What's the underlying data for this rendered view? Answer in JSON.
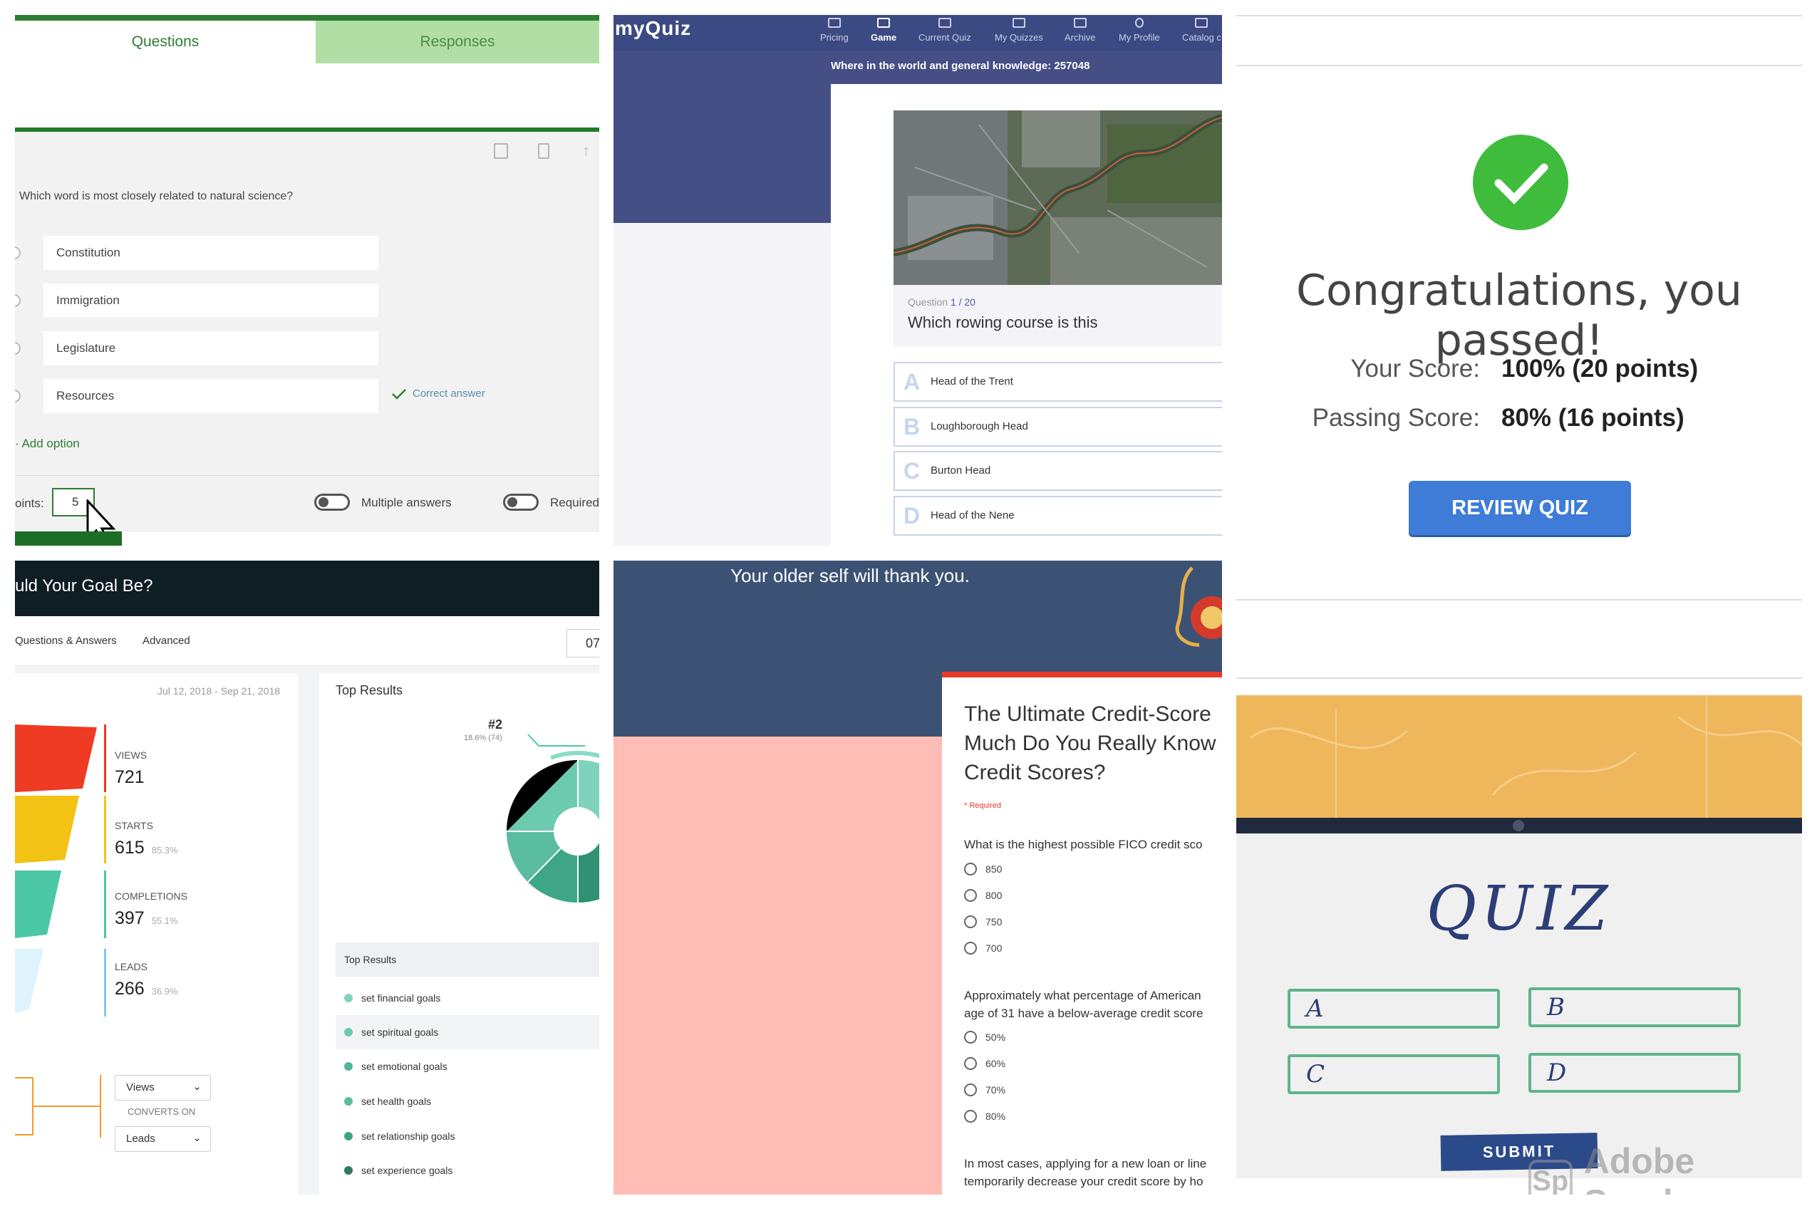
{
  "forms": {
    "tab_questions": "Questions",
    "tab_responses": "Responses",
    "question": "Which word is most closely related to natural science?",
    "options": [
      "Constitution",
      "Immigration",
      "Legislature",
      "Resources"
    ],
    "correct_label": "Correct answer",
    "add_option": "Add option",
    "points_label": "oints:",
    "points_value": "5",
    "multiple_answers": "Multiple answers",
    "required": "Required",
    "accent": "#2e7d32"
  },
  "myquiz": {
    "logo": "myQuiz",
    "nav": [
      "Pricing",
      "Game",
      "Current Quiz",
      "My Quizzes",
      "Archive",
      "My Profile",
      "Catalog c"
    ],
    "active_nav": "Game",
    "subtitle": "Where in the world and general knowledge: 257048",
    "question_label": "Question",
    "question_num": "1 / 20",
    "question_text": "Which rowing course is this",
    "answers": [
      {
        "letter": "A",
        "text": "Head of the Trent"
      },
      {
        "letter": "B",
        "text": "Loughborough Head"
      },
      {
        "letter": "C",
        "text": "Burton Head"
      },
      {
        "letter": "D",
        "text": "Head of the Nene"
      }
    ],
    "accent": "#3b4a82"
  },
  "result": {
    "headline": "Congratulations, you passed!",
    "your_score_label": "Your Score:",
    "your_score_value": "100% (20 points)",
    "passing_score_label": "Passing Score:",
    "passing_score_value": "80% (16 points)",
    "button": "REVIEW QUIZ",
    "check_color": "#3fbc3b"
  },
  "analytics": {
    "header": "uld Your Goal Be?",
    "tabs": [
      "Questions & Answers",
      "Advanced"
    ],
    "date_box": "07",
    "date_range": "Jul 12, 2018 - Sep 21, 2018",
    "metrics": [
      {
        "label": "VIEWS",
        "value": "721",
        "pct": ""
      },
      {
        "label": "STARTS",
        "value": "615",
        "pct": "85.3%"
      },
      {
        "label": "COMPLETIONS",
        "value": "397",
        "pct": "55.1%"
      },
      {
        "label": "LEADS",
        "value": "266",
        "pct": "36.9%"
      }
    ],
    "select_views": "Views",
    "converts_on": "CONVERTS ON",
    "select_leads": "Leads",
    "top_results_title": "Top Results",
    "donut_rank": "#2",
    "donut_pct": "18.6% (74)",
    "list_header": "Top Results",
    "results": [
      "set financial goals",
      "set spiritual goals",
      "set emotional goals",
      "set health goals",
      "set relationship goals",
      "set experience goals"
    ]
  },
  "credit": {
    "headline": "Your older self will thank you.",
    "title": "The Ultimate Credit-Score Much Do You Really Know Credit Scores?",
    "title_lines": [
      "The Ultimate Credit-Score",
      "Much Do You Really Know",
      "Credit Scores?"
    ],
    "required": "* Required",
    "q1": "What is the highest possible FICO credit sco",
    "q1_options": [
      "850",
      "800",
      "750",
      "700"
    ],
    "q2_line1": "Approximately what percentage of American",
    "q2_line2": "age of 31 have a below-average credit score",
    "q2_options": [
      "50%",
      "60%",
      "70%",
      "80%"
    ],
    "q3_line1": "In most cases, applying for a new loan or line",
    "q3_line2": "temporarily decrease your credit score by ho"
  },
  "sketch": {
    "title": "QUIZ",
    "boxes": [
      "A",
      "B",
      "C",
      "D"
    ],
    "submit": "SUBMIT",
    "brand_badge": "Sp",
    "brand_text": "Adobe Spark"
  }
}
